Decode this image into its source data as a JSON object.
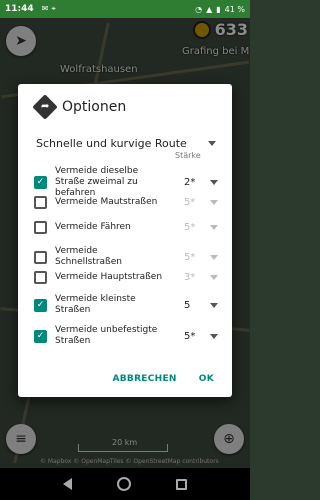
{
  "status_bar": {
    "time": "11:44",
    "battery": "41 %"
  },
  "map": {
    "elevation": "633",
    "places": [
      "Wolfratshausen",
      "Grafing bei M"
    ],
    "scale_label": "20 km",
    "attribution": "© Mapbox © OpenMapTiles © OpenStreetMap contributors"
  },
  "dialog": {
    "title": "Optionen",
    "route_type": "Schnelle und kurvige Route",
    "strength_header": "Stärke",
    "options": [
      {
        "label": "Vermeide dieselbe Straße zweimal zu befahren",
        "checked": true,
        "level": "2*"
      },
      {
        "label": "Vermeide Mautstraßen",
        "checked": false,
        "level": "5*"
      },
      {
        "label": "Vermeide Fähren",
        "checked": false,
        "level": "5*"
      },
      {
        "label": "Vermeide Schnellstraßen",
        "checked": false,
        "level": "5*"
      },
      {
        "label": "Vermeide Hauptstraßen",
        "checked": false,
        "level": "3*"
      },
      {
        "label": "Vermeide kleinste Straßen",
        "checked": true,
        "level": "5"
      },
      {
        "label": "Vermeide unbefestigte Straßen",
        "checked": true,
        "level": "5*"
      }
    ],
    "cancel_label": "ABBRECHEN",
    "ok_label": "OK"
  },
  "colors": {
    "accent": "#00897b",
    "status_bar": "#2e7d32"
  }
}
